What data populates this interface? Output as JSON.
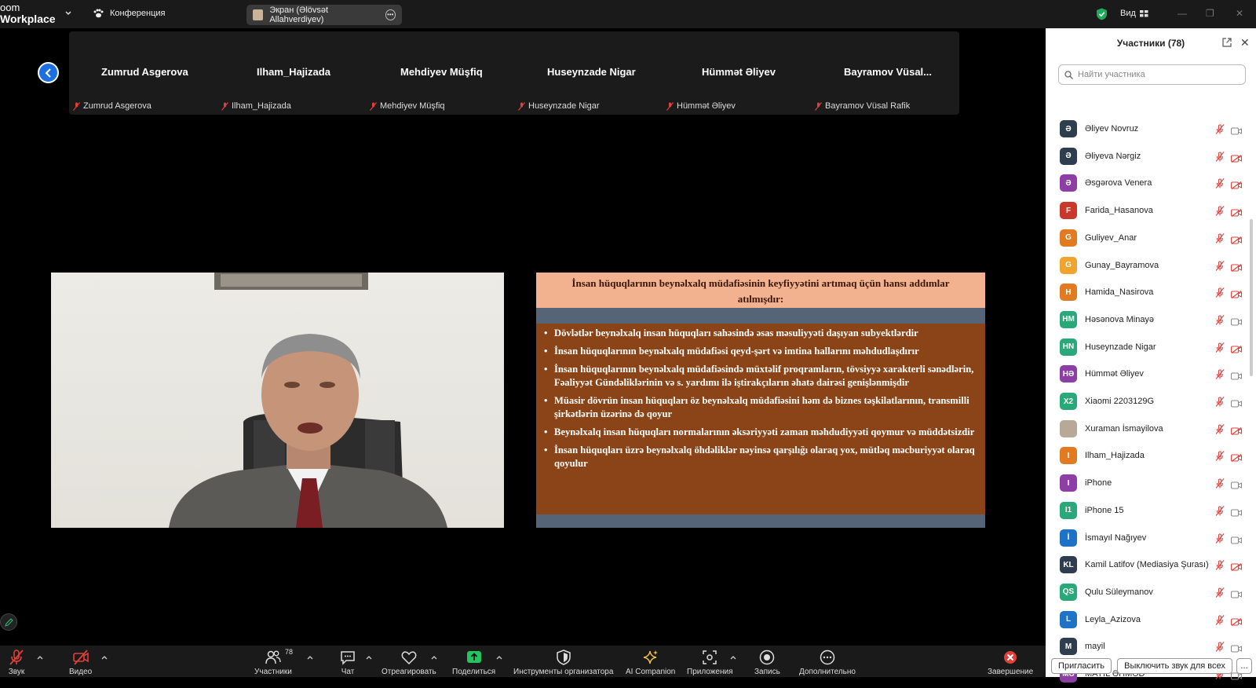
{
  "app": {
    "brand_line1": "oom",
    "brand_line2": "Workplace",
    "meeting_label": "Конференция",
    "screen_share_label": "Экран (Əlövsət Allahverdiyev)",
    "view_label": "Вид"
  },
  "filmstrip": {
    "tiles": [
      {
        "display": "Zumrud Asgerova",
        "label": "Zumrud Asgerova"
      },
      {
        "display": "Ilham_Hajizada",
        "label": "Ilham_Hajizada"
      },
      {
        "display": "Mehdiyev Müşfiq",
        "label": "Mehdiyev Müşfiq"
      },
      {
        "display": "Huseynzade Nigar",
        "label": "Huseynzade Nigar"
      },
      {
        "display": "Hümmət Əliyev",
        "label": "Hümmət Əliyev"
      },
      {
        "display": "Bayramov Vüsal...",
        "label": "Bayramov Vüsal Rafik"
      }
    ]
  },
  "slide": {
    "title": "İnsan hüquqlarının beynəlxalq müdafiəsinin keyfiyyətini artımaq üçün hansı addımlar atılmışdır:",
    "bullets": [
      "Dövlətlər beynəlxalq insan hüquqları sahəsində əsas məsuliyyəti daşıyan subyektlərdir",
      "İnsan hüquqlarının beynəlxalq müdafiəsi qeyd-şərt və imtina hallarını məhdudlaşdırır",
      "İnsan hüquqlarının beynəlxalq müdafiəsində müxtəlif proqramların, tövsiyyə xarakterli sənədlərin, Fəaliyyət Gündəliklərinin və s. yardımı ilə iştirakçıların əhatə dairəsi genişlənmişdir",
      "Müasir dövrün insan hüquqları öz beynəlxalq müdafiəsini həm də biznes təşkilatlarının, transmilli şirkətlərin üzərinə də qoyur",
      "Beynəlxalq insan hüquqları normalarının əksəriyyəti zaman məhdudiyyəti qoymur və müddətsizdir",
      "İnsan hüquqları üzrə beynəlxalq öhdəliklər nəyinsə qarşılığı olaraq yox, mütləq məcburiyyət olaraq qoyulur"
    ]
  },
  "participants": {
    "title": "Участники (78)",
    "search_placeholder": "Найти участника",
    "items": [
      {
        "initials": "Ə",
        "name": "Əliyev Novruz",
        "color": "#2f3e4e",
        "cam_off": false
      },
      {
        "initials": "Ə",
        "name": "Əliyeva Nərgiz",
        "color": "#2f3e4e",
        "cam_off": true
      },
      {
        "initials": "Ə",
        "name": "Əsgərova Venera",
        "color": "#8e3fa6",
        "cam_off": true
      },
      {
        "initials": "F",
        "name": "Farida_Hasanova",
        "color": "#c9392b",
        "cam_off": true
      },
      {
        "initials": "G",
        "name": "Guliyev_Anar",
        "color": "#e07b22",
        "cam_off": true
      },
      {
        "initials": "G",
        "name": "Gunay_Bayramova",
        "color": "#f0a430",
        "cam_off": true
      },
      {
        "initials": "H",
        "name": "Hamida_Nasirova",
        "color": "#e07b22",
        "cam_off": true
      },
      {
        "initials": "HM",
        "name": "Həsənova Minayə",
        "color": "#2aa87a",
        "cam_off": false
      },
      {
        "initials": "HN",
        "name": "Huseynzade Nigar",
        "color": "#2aa87a",
        "cam_off": true
      },
      {
        "initials": "HƏ",
        "name": "Hümmət Əliyev",
        "color": "#8e3fa6",
        "cam_off": false
      },
      {
        "initials": "X2",
        "name": "Xiaomi 2203129G",
        "color": "#2aa87a",
        "cam_off": false
      },
      {
        "initials": "",
        "name": "Xuraman İsmayilova",
        "color": "#b8a898",
        "cam_off": true
      },
      {
        "initials": "I",
        "name": "Ilham_Hajizada",
        "color": "#e07b22",
        "cam_off": true
      },
      {
        "initials": "I",
        "name": "iPhone",
        "color": "#8e3fa6",
        "cam_off": false
      },
      {
        "initials": "I1",
        "name": "iPhone 15",
        "color": "#2aa87a",
        "cam_off": false
      },
      {
        "initials": "İ",
        "name": "İsmayıl Nağıyev",
        "color": "#1f72c6",
        "cam_off": false
      },
      {
        "initials": "KL",
        "name": "Kamil Latifov (Mediasiya Şurası)",
        "color": "#2f3e4e",
        "cam_off": true
      },
      {
        "initials": "QS",
        "name": "Qulu Süleymanov",
        "color": "#2aa87a",
        "cam_off": false
      },
      {
        "initials": "L",
        "name": "Leyla_Azizova",
        "color": "#1f72c6",
        "cam_off": true
      },
      {
        "initials": "M",
        "name": "mayil",
        "color": "#2f3e4e",
        "cam_off": false
      },
      {
        "initials": "MƏ",
        "name": "MAYIL ƏHMƏD",
        "color": "#8e3fa6",
        "cam_off": false
      }
    ],
    "invite_label": "Пригласить",
    "mute_all_label": "Выключить звук для всех",
    "more_label": "..."
  },
  "toolbar": {
    "audio_label": "Звук",
    "video_label": "Видео",
    "participants_label": "Участники",
    "participants_count": "78",
    "chat_label": "Чат",
    "react_label": "Отреагировать",
    "share_label": "Поделиться",
    "host_tools_label": "Инструменты организатора",
    "ai_label": "AI Companion",
    "apps_label": "Приложения",
    "record_label": "Запись",
    "more_label": "Дополнительно",
    "end_label": "Завершение"
  },
  "colors": {
    "accent_blue": "#1c6fe0",
    "mic_off_red": "#e0403a",
    "share_green": "#22c55e",
    "slide_brown": "#8a4417",
    "slide_title_bg": "#f2b28f",
    "slide_band": "#566478"
  }
}
